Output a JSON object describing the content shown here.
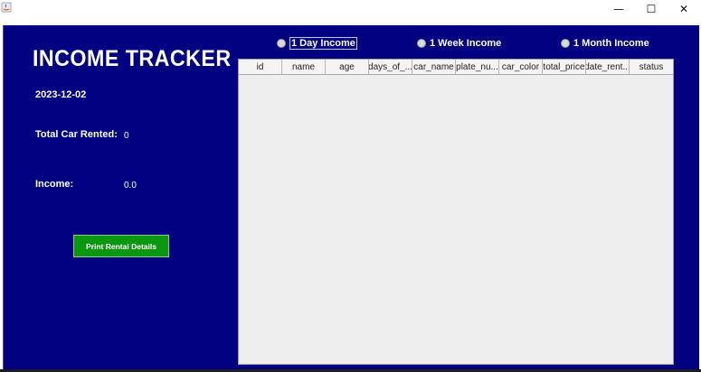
{
  "window": {
    "minimize_glyph": "—",
    "maximize_glyph": "☐",
    "close_glyph": "✕"
  },
  "app": {
    "title": "INCOME TRACKER",
    "date": "2023-12-02",
    "total_rented_label": "Total Car Rented:",
    "total_rented_value": "0",
    "income_label": "Income:",
    "income_value": "0.0",
    "print_button": "Print Rental Details"
  },
  "filters": [
    {
      "label": "1 Day Income",
      "selected": true
    },
    {
      "label": "1 Week Income",
      "selected": false
    },
    {
      "label": "1 Month Income",
      "selected": false
    }
  ],
  "table": {
    "columns": [
      "id",
      "name",
      "age",
      "days_of_...",
      "car_name",
      "plate_nu...",
      "car_color",
      "total_price",
      "date_rent...",
      "status"
    ],
    "rows": []
  },
  "colors": {
    "background": "#000080",
    "button": "#0b9710",
    "table_bg": "#eeeeee"
  }
}
